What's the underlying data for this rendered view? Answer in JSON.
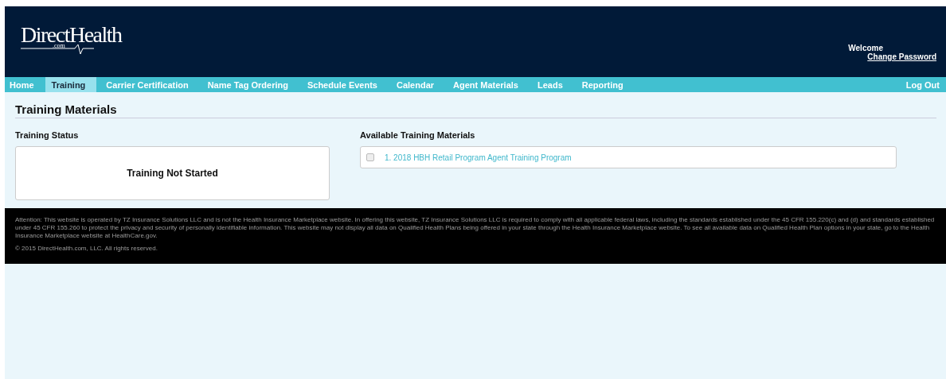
{
  "header": {
    "logo": {
      "name": "DirectHealth",
      "suffix": ".com"
    },
    "welcome": "Welcome",
    "change_password": "Change Password"
  },
  "nav": {
    "items": [
      {
        "label": "Home",
        "selected": false
      },
      {
        "label": "Training",
        "selected": true
      },
      {
        "label": "Carrier Certification",
        "selected": false
      },
      {
        "label": "Name Tag Ordering",
        "selected": false
      },
      {
        "label": "Schedule Events",
        "selected": false
      },
      {
        "label": "Calendar",
        "selected": false
      },
      {
        "label": "Agent Materials",
        "selected": false
      },
      {
        "label": "Leads",
        "selected": false
      },
      {
        "label": "Reporting",
        "selected": false
      }
    ],
    "logout": "Log Out"
  },
  "page_title": "Training Materials",
  "training_status": {
    "heading": "Training Status",
    "status": "Training Not Started"
  },
  "available": {
    "heading": "Available Training Materials",
    "items": [
      {
        "label": "1. 2018 HBH Retail Program Agent Training Program",
        "checked": false
      }
    ]
  },
  "footer": {
    "notice": "Attention: This website is operated by TZ Insurance Solutions LLC and is not the Health Insurance Marketplace website. In offering this website, TZ Insurance Solutions LLC is required to comply with all applicable federal laws, including the standards established under the 45 CFR 155.220(c) and (d) and standards established under 45 CFR 155.260 to protect the privacy and security of personally identifiable information. This website may not display all data on Qualified Health Plans being offered in your state through the Health Insurance Marketplace website. To see all available data on Qualified Health Plan options in your state, go to the Health Insurance Marketplace website at HealthCare.gov.",
    "copyright": "© 2015 DirectHealth.com, LLC. All rights reserved."
  }
}
